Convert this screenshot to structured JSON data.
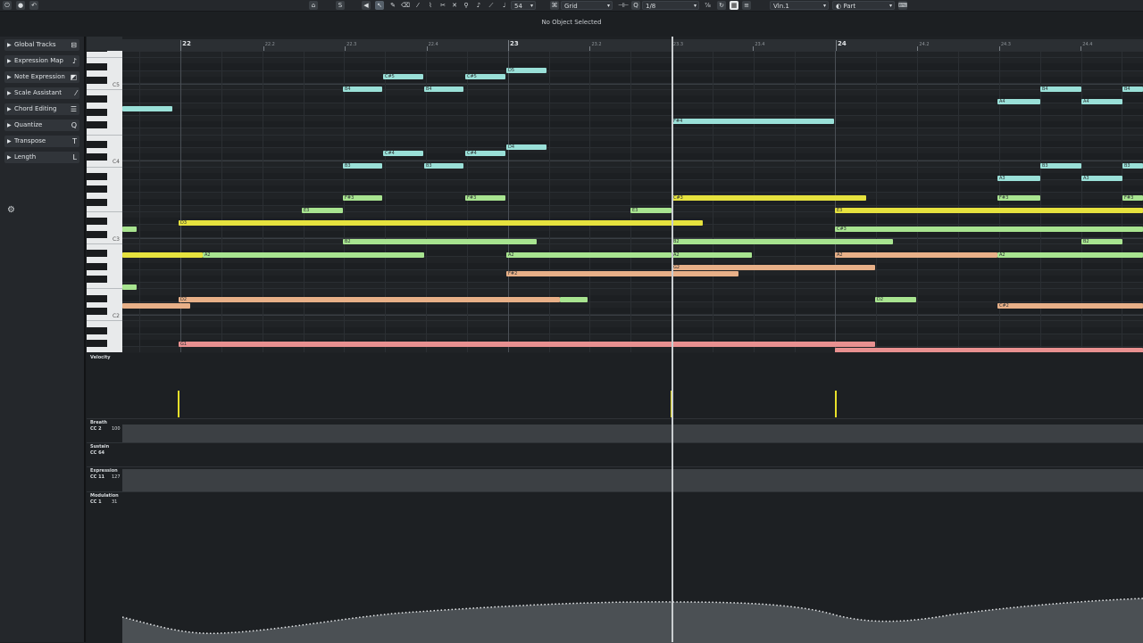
{
  "toolbar": {
    "quantize_value": "54",
    "snap_type": "Grid",
    "quantize_grid": "1/8",
    "instrument": "Vln.1",
    "mode": "Part",
    "icons": [
      "record-icon",
      "stop-icon",
      "lock-icon",
      "arrow-icon",
      "pencil-icon",
      "eraser-icon",
      "glue-icon",
      "scissors-icon",
      "mute-icon",
      "zoom-icon",
      "line-icon",
      "drum-icon",
      "speaker-icon",
      "quantize-icon",
      "color-icon"
    ]
  },
  "info": {
    "text": "No Object Selected"
  },
  "inspector": {
    "items": [
      {
        "label": "Global Tracks",
        "icon": "global-tracks-icon"
      },
      {
        "label": "Expression Map",
        "icon": "expression-map-icon"
      },
      {
        "label": "Note Expression",
        "icon": "note-expression-icon"
      },
      {
        "label": "Scale Assistant",
        "icon": "scale-icon"
      },
      {
        "label": "Chord Editing",
        "icon": "chord-icon"
      },
      {
        "label": "Quantize",
        "icon": "quantize-icon"
      },
      {
        "label": "Transpose",
        "icon": "transpose-icon"
      },
      {
        "label": "Length",
        "icon": "length-icon"
      }
    ]
  },
  "ruler": {
    "bars": [
      {
        "label": "22",
        "pos": 0.057
      },
      {
        "label": "23",
        "pos": 0.378
      },
      {
        "label": "24",
        "pos": 0.699
      }
    ],
    "subs": [
      {
        "label": "22.2",
        "pos": 0.138
      },
      {
        "label": "22.3",
        "pos": 0.218
      },
      {
        "label": "22.4",
        "pos": 0.298
      },
      {
        "label": "23.2",
        "pos": 0.458
      },
      {
        "label": "23.3",
        "pos": 0.538
      },
      {
        "label": "23.4",
        "pos": 0.618
      },
      {
        "label": "24.2",
        "pos": 0.779
      },
      {
        "label": "24.3",
        "pos": 0.859
      },
      {
        "label": "24.4",
        "pos": 0.939
      }
    ]
  },
  "keyboard": {
    "labels": [
      {
        "text": "C5"
      },
      {
        "text": "C4"
      },
      {
        "text": "C3"
      },
      {
        "text": "C2"
      }
    ]
  },
  "notes": [
    {
      "text": "",
      "color": "#9ae0d8"
    },
    {
      "text": "C#5",
      "color": "#9ae0d8"
    },
    {
      "text": "B4",
      "color": "#9ae0d8"
    },
    {
      "text": "C#5",
      "color": "#9ae0d8"
    },
    {
      "text": "B4",
      "color": "#9ae0d8"
    },
    {
      "text": "D5",
      "color": "#9ae0d8"
    },
    {
      "text": "F#4",
      "color": "#9ae0d8"
    },
    {
      "text": "C#4",
      "color": "#9ae0d8"
    },
    {
      "text": "B3",
      "color": "#9ae0d8"
    },
    {
      "text": "C#4",
      "color": "#9ae0d8"
    },
    {
      "text": "B3",
      "color": "#9ae0d8"
    },
    {
      "text": "D4",
      "color": "#9ae0d8"
    },
    {
      "text": "F#3",
      "color": "#a8e490"
    },
    {
      "text": "F#3",
      "color": "#a8e490"
    },
    {
      "text": "E3",
      "color": "#a8e490"
    },
    {
      "text": "E3",
      "color": "#a8e490"
    },
    {
      "text": "D3",
      "color": "#e6e23e"
    },
    {
      "text": "",
      "color": "#a8e490"
    },
    {
      "text": "B2",
      "color": "#a8e490"
    },
    {
      "text": "",
      "color": "#e6e23e"
    },
    {
      "text": "A2",
      "color": "#a8e490"
    },
    {
      "text": "A2",
      "color": "#a8e490"
    },
    {
      "text": "F#2",
      "color": "#e8b088"
    },
    {
      "text": "",
      "color": "#a8e490"
    },
    {
      "text": "D2",
      "color": "#e8b088"
    },
    {
      "text": "",
      "color": "#e8b088"
    },
    {
      "text": "",
      "color": "#a8e490"
    },
    {
      "text": "G1",
      "color": "#e89090"
    },
    {
      "text": "C#3",
      "color": "#e6e23e"
    },
    {
      "text": "B2",
      "color": "#a8e490"
    },
    {
      "text": "A2",
      "color": "#a8e490"
    },
    {
      "text": "G2",
      "color": "#e8b088"
    },
    {
      "text": "E3",
      "color": "#e6e23e"
    },
    {
      "text": "C#3",
      "color": "#a8e490"
    },
    {
      "text": "A2",
      "color": "#e8b088"
    },
    {
      "text": "D2",
      "color": "#a8e490"
    },
    {
      "text": "A2",
      "color": "#a8e490"
    },
    {
      "text": "C#2",
      "color": "#e8b088"
    },
    {
      "text": "B4",
      "color": "#9ae0d8"
    },
    {
      "text": "A4",
      "color": "#9ae0d8"
    },
    {
      "text": "B3",
      "color": "#9ae0d8"
    },
    {
      "text": "A3",
      "color": "#9ae0d8"
    },
    {
      "text": "F#3",
      "color": "#a8e490"
    },
    {
      "text": "B4",
      "color": "#9ae0d8"
    },
    {
      "text": "A4",
      "color": "#9ae0d8"
    },
    {
      "text": "B3",
      "color": "#9ae0d8"
    },
    {
      "text": "A3",
      "color": "#9ae0d8"
    },
    {
      "text": "F#3",
      "color": "#a8e490"
    },
    {
      "text": "B2",
      "color": "#a8e490"
    },
    {
      "text": "",
      "color": "#e89090"
    }
  ],
  "lanes": {
    "velocity": {
      "label": "Velocity"
    },
    "breath": {
      "label": "Breath",
      "cc": "CC 2",
      "value": "100"
    },
    "sustain": {
      "label": "Sustain",
      "cc": "CC 64"
    },
    "expression": {
      "label": "Expression",
      "cc": "CC 11",
      "value": "127"
    },
    "modulation": {
      "label": "Modulation",
      "cc": "CC 1",
      "value": "31"
    }
  },
  "colors": {
    "teal": "#9ae0d8",
    "green": "#a8e490",
    "yellow": "#e6e23e",
    "orange": "#e8b088",
    "red": "#e89090"
  }
}
